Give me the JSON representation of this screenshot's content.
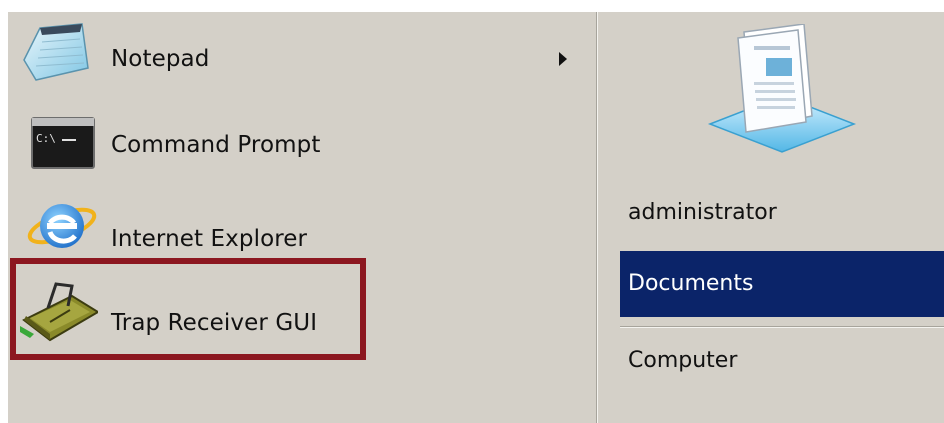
{
  "programs": [
    {
      "label": "Notepad",
      "icon": "notepad-icon",
      "has_submenu": true
    },
    {
      "label": "Command Prompt",
      "icon": "command-prompt-icon",
      "has_submenu": false
    },
    {
      "label": "Internet Explorer",
      "icon": "internet-explorer-icon",
      "has_submenu": false
    },
    {
      "label": "Trap Receiver GUI",
      "icon": "trap-receiver-icon",
      "has_submenu": false,
      "highlighted": true
    }
  ],
  "places": {
    "user_icon": "documents-icon",
    "items": [
      {
        "label": "administrator",
        "selected": false
      },
      {
        "label": "Documents",
        "selected": true
      },
      {
        "label": "Computer",
        "selected": false
      }
    ]
  },
  "colors": {
    "menu_bg": "#d4d0c8",
    "selection_bg": "#0b2469",
    "highlight_border": "#8c1720"
  }
}
